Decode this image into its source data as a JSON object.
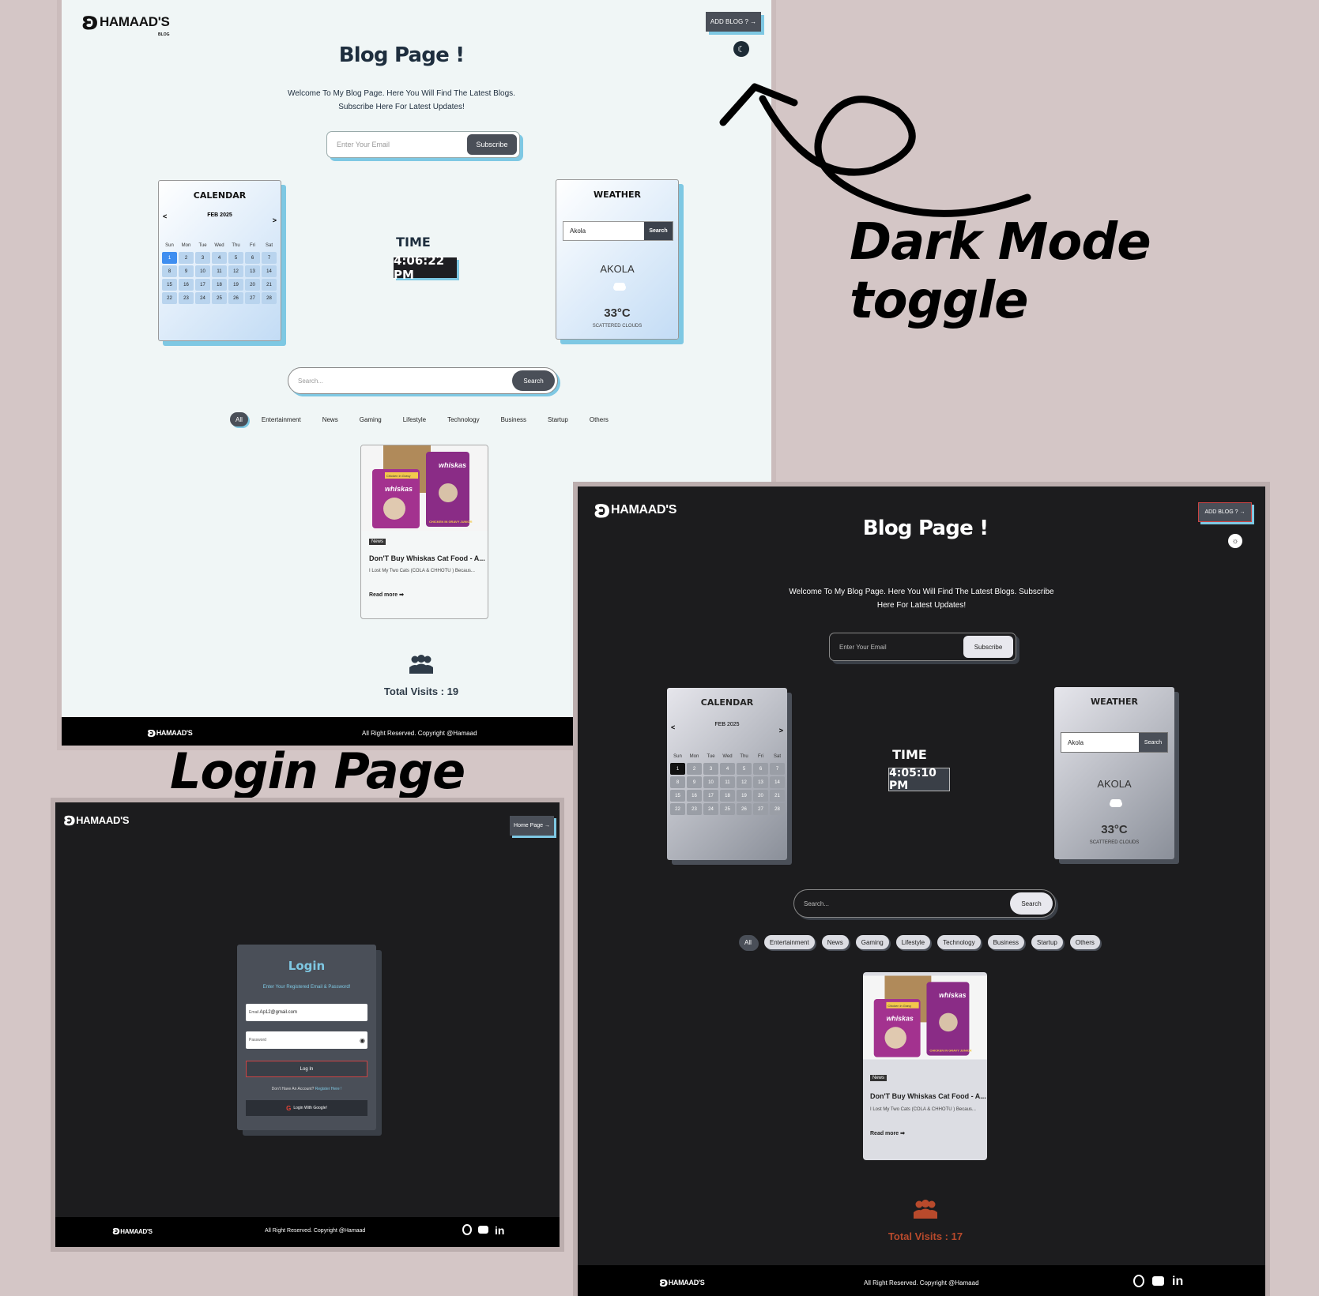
{
  "brand": {
    "name": "HAMAAD'S",
    "sub": "BLOG"
  },
  "blog": {
    "add_blog": "ADD BLOG ? →",
    "title": "Blog Page !",
    "description": "Welcome To My Blog Page. Here You Will Find The Latest Blogs. Subscribe Here For Latest Updates!",
    "email_placeholder": "Enter Your Email",
    "subscribe": "Subscribe",
    "calendar": {
      "title": "CALENDAR",
      "month": "FEB 2025",
      "prev": "<",
      "next": ">",
      "days": [
        "Sun",
        "Mon",
        "Tue",
        "Wed",
        "Thu",
        "Fri",
        "Sat"
      ],
      "weeks": [
        [
          "1",
          "2",
          "3",
          "4",
          "5",
          "6",
          "7"
        ],
        [
          "8",
          "9",
          "10",
          "11",
          "12",
          "13",
          "14"
        ],
        [
          "15",
          "16",
          "17",
          "18",
          "19",
          "20",
          "21"
        ],
        [
          "22",
          "23",
          "24",
          "25",
          "26",
          "27",
          "28"
        ]
      ],
      "selected": "1"
    },
    "time_label": "TIME",
    "weather": {
      "title": "WEATHER",
      "city_input": "Akola",
      "search": "Search",
      "city": "AKOLA",
      "temp": "33°C",
      "condition": "SCATTERED CLOUDS"
    },
    "search_placeholder": "Search...",
    "search_button": "Search",
    "categories": [
      "All",
      "Entertainment",
      "News",
      "Gaming",
      "Lifestyle",
      "Technology",
      "Business",
      "Startup",
      "Others"
    ],
    "post": {
      "tag": "News",
      "title": "Don'T Buy Whiskas Cat Food - A...",
      "excerpt": "I Lost My Two Cats (COLA & CHHOTU ) Becaus...",
      "read_more": "Read more ➡",
      "pack_brand": "whiskas",
      "pack_flavor": "Chicken in Gravy",
      "pack_label": "CHICKEN IN GRAVY JUNIOR"
    },
    "copyright": "All Right Reserved. Copyright @Hamaad"
  },
  "light": {
    "time": "4:06:22 PM",
    "visits": "Total Visits : 19"
  },
  "dark": {
    "time": "4:05:10 PM",
    "visits": "Total Visits : 17"
  },
  "login": {
    "home_button": "Home Page →",
    "title": "Login",
    "subtitle": "Enter Your Registered Email & Password!",
    "email_label": "Email",
    "email_value": "Ap12@gmail.com",
    "password_placeholder": "Password",
    "login_button": "Log In",
    "no_account": "Don't Have An Account?",
    "register": "Register Here !",
    "google_button": "Login With Google!",
    "google_letter": "G"
  },
  "annotations": {
    "dark_mode": "Dark Mode toggle",
    "login_page": "Login Page"
  },
  "icons": {
    "moon": "moon-icon",
    "sun": "sun-icon",
    "cloud": "cloud-icon",
    "users": "users-icon",
    "github": "github-icon",
    "youtube": "youtube-icon",
    "linkedin": "linkedin-icon",
    "eye": "eye-icon",
    "google": "google-icon",
    "arrow": "curved-arrow-icon"
  },
  "colors": {
    "accent_blue": "#7ec8e3",
    "dark_bg": "#1c1c1e",
    "light_bg": "#f0f6f6",
    "visits_dark": "#b84a2c",
    "selected_day": "#3f8ef0",
    "page_bg": "#d4c6c6"
  }
}
